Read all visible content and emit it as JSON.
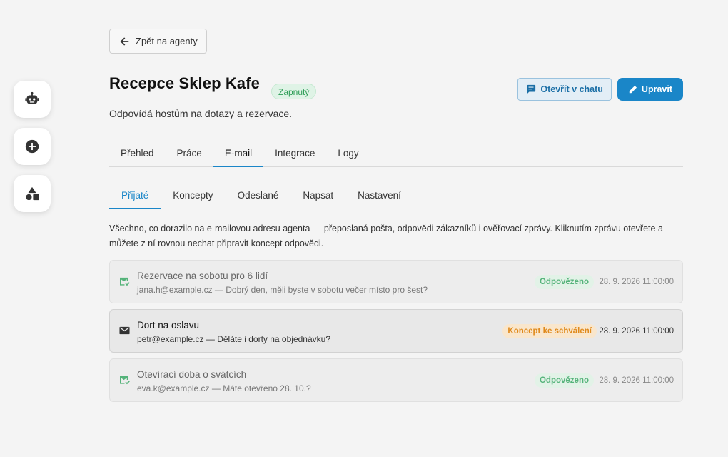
{
  "rail": {
    "items": [
      {
        "icon": "robot-icon"
      },
      {
        "icon": "plus-circle-icon"
      },
      {
        "icon": "shapes-icon"
      }
    ]
  },
  "back": {
    "label": "Zpět na agenty"
  },
  "agent": {
    "name": "Recepce Sklep Kafe",
    "status": "Zapnutý",
    "description": "Odpovídá hostům na dotazy a rezervace."
  },
  "actions": {
    "open_chat": "Otevřít v chatu",
    "edit": "Upravit"
  },
  "tabs": [
    {
      "label": "Přehled"
    },
    {
      "label": "Práce"
    },
    {
      "label": "E-mail"
    },
    {
      "label": "Integrace"
    },
    {
      "label": "Logy"
    }
  ],
  "subtabs": [
    {
      "label": "Přijaté"
    },
    {
      "label": "Koncepty"
    },
    {
      "label": "Odeslané"
    },
    {
      "label": "Napsat"
    },
    {
      "label": "Nastavení"
    }
  ],
  "inbox_description": "Všechno, co dorazilo na e-mailovou adresu agenta — přeposlaná pošta, odpovědi zákazníků i ověřovací zprávy. Kliknutím zprávu otevřete a můžete z ní rovnou nechat připravit koncept odpovědi.",
  "messages": [
    {
      "subject": "Rezervace na sobotu pro 6 lidí",
      "preview": "jana.h@example.cz — Dobrý den, měli byste v sobotu večer místo pro šest?",
      "status": "Odpovězeno",
      "date": "28. 9. 2026 11:00:00"
    },
    {
      "subject": "Dort na oslavu",
      "preview": "petr@example.cz — Děláte i dorty na objednávku?",
      "status": "Koncept ke schválení",
      "date": "28. 9. 2026 11:00:00"
    },
    {
      "subject": "Otevírací doba o svátcích",
      "preview": "eva.k@example.cz — Máte otevřeno 28. 10.?",
      "status": "Odpovězeno",
      "date": "28. 9. 2026 11:00:00"
    }
  ],
  "colors": {
    "accent": "#1a86c8",
    "status_on": "#2e9d57",
    "answered": "#55b37a",
    "draft": "#e08a1c"
  }
}
